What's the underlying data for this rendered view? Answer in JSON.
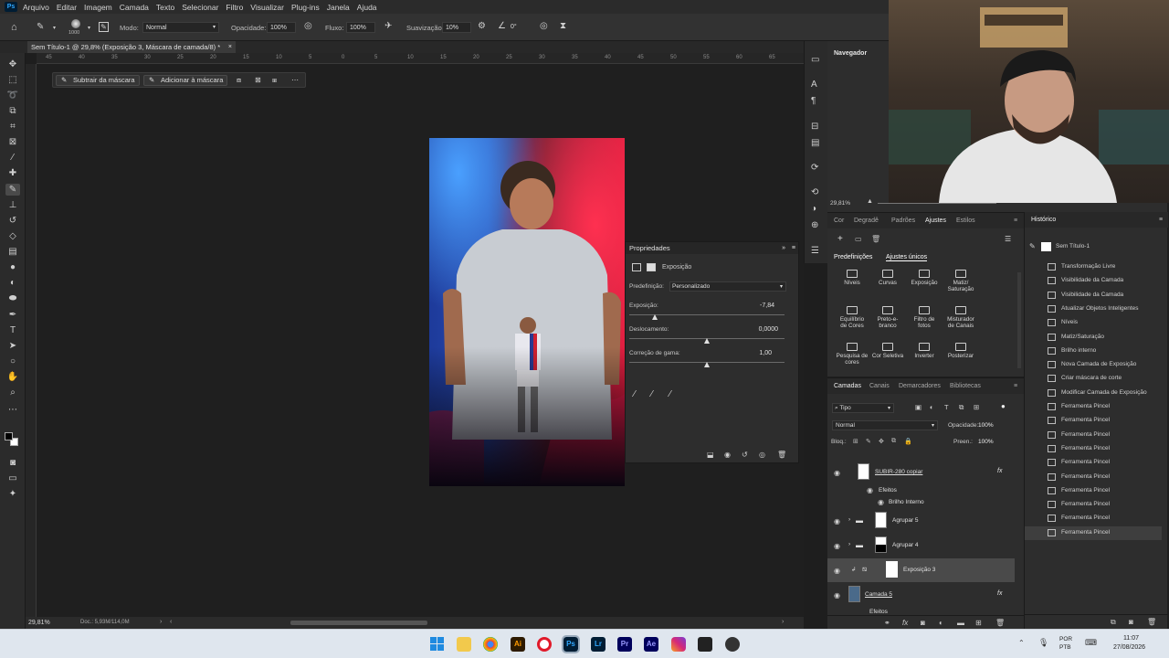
{
  "app": {
    "logo": "Ps",
    "menu": [
      "Arquivo",
      "Editar",
      "Imagem",
      "Camada",
      "Texto",
      "Selecionar",
      "Filtro",
      "Visualizar",
      "Plug-ins",
      "Janela",
      "Ajuda"
    ]
  },
  "options_bar": {
    "brush_size": "1000",
    "mode_label": "Modo:",
    "mode_value": "Normal",
    "opacity_label": "Opacidade:",
    "opacity_value": "100%",
    "flow_label": "Fluxo:",
    "flow_value": "100%",
    "smoothing_label": "Suavização:",
    "smoothing_value": "10%",
    "angle_value": "0°"
  },
  "document": {
    "tab_title": "Sem Título-1 @ 29,8% (Exposição 3, Máscara de camada/8) *",
    "zoom": "29,81%",
    "doc_info": "Doc.: 5,93M/114,0M"
  },
  "ruler_top_ticks": [
    "45",
    "40",
    "35",
    "30",
    "25",
    "20",
    "15",
    "10",
    "5",
    "0",
    "5",
    "10",
    "15",
    "20",
    "25",
    "30",
    "35",
    "40",
    "45",
    "50",
    "55",
    "60",
    "65"
  ],
  "context_bar": {
    "subtract_label": "Subtrair da máscara",
    "add_label": "Adicionar à máscara"
  },
  "properties": {
    "title": "Propriedades",
    "adjustment_name": "Exposição",
    "preset_label": "Predefinição:",
    "preset_value": "Personalizado",
    "exposure_label": "Exposição:",
    "exposure_value": "-7,84",
    "exposure_fraction": 0.17,
    "offset_label": "Deslocamento:",
    "offset_value": "0,0000",
    "offset_fraction": 0.5,
    "gamma_label": "Correção de gama:",
    "gamma_value": "1,00",
    "gamma_fraction": 0.5
  },
  "navigator": {
    "title": "Navegador",
    "zoom": "29,81%"
  },
  "adjustments_panel": {
    "tabs": [
      "Cor",
      "Degradê",
      "Padrões",
      "Ajustes",
      "Estilos"
    ],
    "active_tab": "Ajustes",
    "sub_tabs": [
      "Predefinições",
      "Ajustes únicos"
    ],
    "items": [
      [
        "Níveis"
      ],
      [
        "Curvas"
      ],
      [
        "Exposição"
      ],
      [
        "Matiz/",
        "Saturação"
      ],
      [
        "Equilíbrio",
        "de Cores"
      ],
      [
        "Preto-e-",
        "branco"
      ],
      [
        "Filtro de",
        "fotos"
      ],
      [
        "Misturador",
        "de Canais"
      ],
      [
        "Pesquisa de",
        "cores"
      ],
      [
        "Cor Seletiva"
      ],
      [
        "Inverter"
      ],
      [
        "Posterizar"
      ]
    ]
  },
  "layers_panel": {
    "tabs": [
      "Camadas",
      "Canais",
      "Demarcadores",
      "Bibliotecas"
    ],
    "filter_value": "Tipo",
    "blend_mode": "Normal",
    "opacity_label": "Opacidade:",
    "opacity_value": "100%",
    "lock_label": "Bloq.:",
    "fill_label": "Preen.:",
    "fill_value": "100%",
    "layers": [
      {
        "name": "SUBIR-280 copiar",
        "fx": "fx"
      },
      {
        "name": "Efeitos"
      },
      {
        "name": "Brilho Interno"
      },
      {
        "name": "Agrupar 5"
      },
      {
        "name": "Agrupar 4"
      },
      {
        "name": "Exposição 3"
      },
      {
        "name": "Camada 5",
        "fx": "fx"
      },
      {
        "name": "Efeitos"
      }
    ]
  },
  "history": {
    "title": "Histórico",
    "snapshot": "Sem Título-1",
    "items": [
      "Transformação Livre",
      "Visibilidade da Camada",
      "Visibilidade da Camada",
      "Atualizar Objetos Inteligentes",
      "Níveis",
      "Matiz/Saturação",
      "Brilho interno",
      "Nova Camada de Exposição",
      "Criar máscara de corte",
      "Modificar Camada de Exposição",
      "Ferramenta Pincel",
      "Ferramenta Pincel",
      "Ferramenta Pincel",
      "Ferramenta Pincel",
      "Ferramenta Pincel",
      "Ferramenta Pincel",
      "Ferramenta Pincel",
      "Ferramenta Pincel",
      "Ferramenta Pincel",
      "Ferramenta Pincel"
    ]
  },
  "taskbar": {
    "lang_1": "POR",
    "lang_2": "PTB",
    "time": "11:07",
    "date": "27/08/2026",
    "apps": [
      "Ai",
      "Ps",
      "Lr",
      "Pr",
      "Ae"
    ]
  },
  "colors": {
    "accent": "#31a8ff",
    "panel": "#2d2d2d",
    "canvas": "#1f1f1f"
  }
}
